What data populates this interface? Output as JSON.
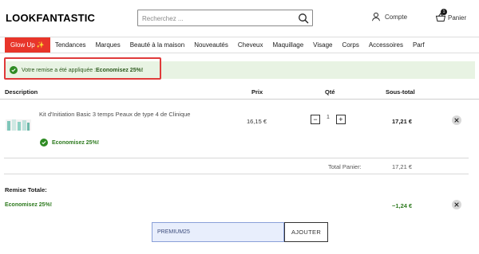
{
  "header": {
    "logo": "LOOKFANTASTIC",
    "search_placeholder": "Recherchez ...",
    "account_label": "Compte",
    "cart_label": "Panier",
    "cart_count": "1"
  },
  "nav": {
    "items": [
      {
        "label": "Glow Up ✨"
      },
      {
        "label": "Tendances"
      },
      {
        "label": "Marques"
      },
      {
        "label": "Beauté à la maison"
      },
      {
        "label": "Nouveautés"
      },
      {
        "label": "Cheveux"
      },
      {
        "label": "Maquillage"
      },
      {
        "label": "Visage"
      },
      {
        "label": "Corps"
      },
      {
        "label": "Accessoires"
      },
      {
        "label": "Parf"
      }
    ]
  },
  "alert": {
    "text": "Votre remise a été appliquée : ",
    "strong": "Economisez 25%!"
  },
  "table": {
    "headers": {
      "description": "Description",
      "price": "Prix",
      "qty": "Qté",
      "subtotal": "Sous-total"
    },
    "item": {
      "name": "Kit d'Initiation Basic 3 temps Peaux de type 4 de Clinique",
      "saving": "Economisez 25%!",
      "price": "16,15 €",
      "qty_minus": "−",
      "qty_value": "1",
      "qty_plus": "+",
      "subtotal": "17,21 €"
    },
    "total_label": "Total Panier:",
    "total_value": "17,21 €"
  },
  "discount": {
    "heading": "Remise Totale:",
    "name": "Economisez 25%!",
    "value": "−1,24 €"
  },
  "promo": {
    "code": "PREMIUM25",
    "apply_label": "AJOUTER"
  },
  "colors": {
    "brand_red": "#e8352a",
    "success_green": "#2e8b23",
    "alert_bg": "#e8f3e3"
  }
}
